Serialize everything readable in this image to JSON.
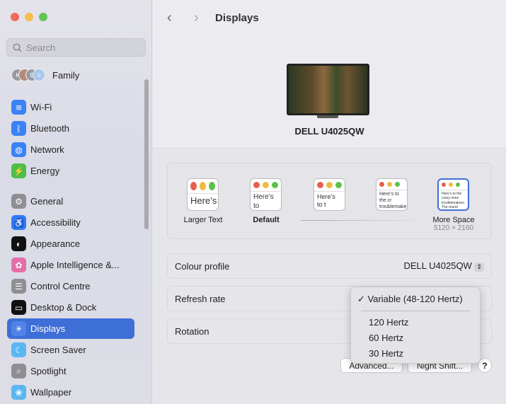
{
  "window": {
    "title": "Displays"
  },
  "search": {
    "placeholder": "Search"
  },
  "sidebar": {
    "family": "Family",
    "items": [
      {
        "label": "Wi-Fi",
        "icon": "wifi-icon",
        "color": "#3b82f6"
      },
      {
        "label": "Bluetooth",
        "icon": "bluetooth-icon",
        "color": "#3b82f6"
      },
      {
        "label": "Network",
        "icon": "globe-icon",
        "color": "#3b82f6"
      },
      {
        "label": "Energy",
        "icon": "bolt-icon",
        "color": "#4cbf4a"
      },
      {
        "label": "General",
        "icon": "gear-icon",
        "color": "#8e8e93"
      },
      {
        "label": "Accessibility",
        "icon": "accessibility-icon",
        "color": "#2f7bf5"
      },
      {
        "label": "Appearance",
        "icon": "appearance-icon",
        "color": "#111111"
      },
      {
        "label": "Apple Intelligence &...",
        "icon": "apple-intelligence-icon",
        "color": "#e36fa8"
      },
      {
        "label": "Control Centre",
        "icon": "control-centre-icon",
        "color": "#8e8e93"
      },
      {
        "label": "Desktop & Dock",
        "icon": "dock-icon",
        "color": "#111111"
      },
      {
        "label": "Displays",
        "icon": "sun-icon",
        "color": "#3e6fd6"
      },
      {
        "label": "Screen Saver",
        "icon": "screen-saver-icon",
        "color": "#5ab6f0"
      },
      {
        "label": "Spotlight",
        "icon": "magnifier-icon",
        "color": "#8e8e93"
      },
      {
        "label": "Wallpaper",
        "icon": "flower-icon",
        "color": "#5ab6f0"
      }
    ]
  },
  "display": {
    "name": "DELL U4025QW"
  },
  "resolution": {
    "options": [
      {
        "label": "Larger Text",
        "sample": "Here’s"
      },
      {
        "label": "Default",
        "sample": "Here’s to troublem"
      },
      {
        "label": "",
        "sample": "Here’s to t troublema ones who"
      },
      {
        "label": "",
        "sample": "Here’s to the cr troublemakers. ones who see t rules. And they"
      },
      {
        "label": "More Space",
        "sample": "Here’s to the crazy ones troublemakers. The round ones who see things diff rules. And they have no can quote them, disagree them. About the only thi Because they change th",
        "sub": "5120 × 2160"
      }
    ]
  },
  "settings": {
    "colour_profile_label": "Colour profile",
    "colour_profile_value": "DELL U4025QW",
    "refresh_label": "Refresh rate",
    "rotation_label": "Rotation"
  },
  "refresh_menu": {
    "selected": "Variable (48-120 Hertz)",
    "check": "✓",
    "options": [
      "120 Hertz",
      "60 Hertz",
      "30 Hertz"
    ]
  },
  "buttons": {
    "advanced": "Advanced...",
    "night_shift": "Night Shift...",
    "help": "?"
  }
}
